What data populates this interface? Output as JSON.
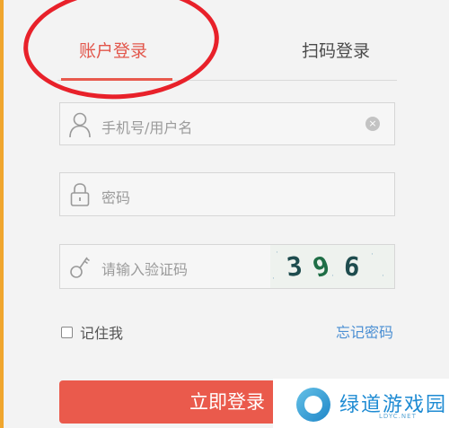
{
  "tabs": {
    "account_login": "账户登录",
    "qr_login": "扫码登录"
  },
  "fields": {
    "username_placeholder": "手机号/用户名",
    "password_placeholder": "密码",
    "captcha_placeholder": "请输入验证码",
    "captcha_chars": [
      "3",
      "9",
      "6"
    ],
    "clear_symbol": "×"
  },
  "remember": {
    "label": "记住我",
    "checked": false
  },
  "forgot_label": "忘记密码",
  "login_button": "立即登录",
  "watermark": {
    "title": "绿道游戏园",
    "subtitle": "LDYC.NET"
  },
  "colors": {
    "accent": "#e8594d",
    "link": "#4b8fd3",
    "annotation_circle": "#e8212a"
  },
  "icons": {
    "username": "user-icon",
    "password": "lock-icon",
    "captcha": "key-icon",
    "clear": "clear-icon"
  }
}
